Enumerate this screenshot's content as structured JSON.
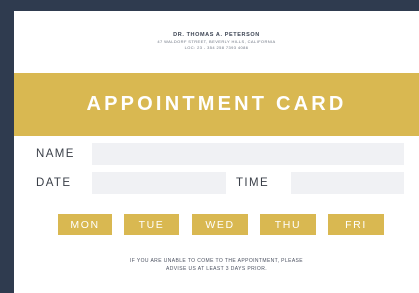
{
  "header": {
    "doctor_name": "DR. THOMAS A. PETERSON",
    "address": "47 WALDORF STREET, BEVERLY HILLS, CALIFORNIA",
    "contact": "LOC: 23 - 354 258 7393 4086"
  },
  "title": "APPOINTMENT CARD",
  "fields": {
    "name_label": "NAME",
    "date_label": "DATE",
    "time_label": "TIME"
  },
  "days": [
    "MON",
    "TUE",
    "WED",
    "THU",
    "FRI"
  ],
  "footer": {
    "line1": "IF YOU ARE UNABLE TO COME TO THE APPOINTMENT, PLEASE",
    "line2": "ADVISE US AT LEAST 3 DAYS PRIOR."
  },
  "colors": {
    "accent": "#d9b851",
    "background": "#2f3b4f",
    "field": "#f0f1f4"
  }
}
